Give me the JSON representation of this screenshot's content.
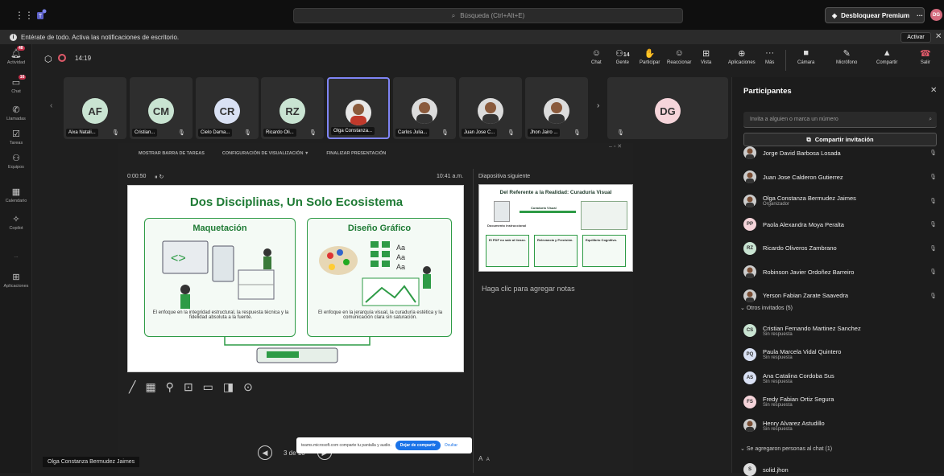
{
  "topbar": {
    "search_placeholder": "Búsqueda (Ctrl+Alt+E)",
    "premium_label": "Desbloquear Premium",
    "more": "···",
    "avatar": "DG"
  },
  "notif": {
    "text": "Entérate de todo. Activa las notificaciones de escritorio.",
    "button": "Activar"
  },
  "rail": [
    {
      "label": "Actividad",
      "badge": "48",
      "icon": "bell-icon"
    },
    {
      "label": "Chat",
      "badge": "16",
      "icon": "chat-icon"
    },
    {
      "label": "Llamadas",
      "icon": "phone-icon"
    },
    {
      "label": "Tareas",
      "icon": "tasks-icon"
    },
    {
      "label": "Equipos",
      "icon": "teams-icon"
    },
    {
      "label": "Calendario",
      "icon": "calendar-icon"
    },
    {
      "label": "Copilot",
      "icon": "copilot-icon"
    },
    {
      "label": "···",
      "icon": "more-icon"
    },
    {
      "label": "Aplicaciones",
      "icon": "apps-icon"
    }
  ],
  "meeting": {
    "timer": "14:19",
    "toolbar": [
      {
        "label": "Chat"
      },
      {
        "label": "Gente",
        "count": "14"
      },
      {
        "label": "Participar"
      },
      {
        "label": "Reaccionar"
      },
      {
        "label": "Vista"
      },
      {
        "label": "Aplicaciones"
      },
      {
        "label": "Más"
      },
      {
        "label": "Cámara"
      },
      {
        "label": "Micrófono"
      },
      {
        "label": "Compartir"
      },
      {
        "label": "Salir"
      }
    ]
  },
  "tiles": [
    {
      "initials": "AF",
      "name": "Aixa Natali...",
      "color": "#c9e4d2"
    },
    {
      "initials": "CM",
      "name": "Cristian...",
      "color": "#c9e4d2"
    },
    {
      "initials": "CR",
      "name": "Cielo Dama...",
      "color": "#d9e1f4"
    },
    {
      "initials": "RZ",
      "name": "Ricardo Oli...",
      "color": "#c9e4d2"
    },
    {
      "initials": "",
      "name": "Olga Constanza...",
      "color": "#ddd"
    },
    {
      "initials": "",
      "name": "Carlos Julia...",
      "color": "#ddd"
    },
    {
      "initials": "",
      "name": "Juan Jose C...",
      "color": "#ddd"
    },
    {
      "initials": "",
      "name": "Jhon Jairo ...",
      "color": "#ddd"
    },
    {
      "initials": "DG",
      "name": "",
      "color": "#f5d4da"
    }
  ],
  "presenter": {
    "toolbar": [
      "MOSTRAR BARRA DE TAREAS",
      "CONFIGURACIÓN DE VISUALIZACIÓN ▼",
      "FINALIZAR PRESENTACIÓN"
    ],
    "elapsed": "0:00:50",
    "clock": "10:41 a.m.",
    "next_label": "Diapositiva siguiente",
    "notes": "Haga clic para agregar notas",
    "page": "3 de 10",
    "presenter_name": "Olga Constanza Bermudez Jaimes",
    "share_notice": "teams.microsoft.com comparte tu pantalla y audio.",
    "stop_share": "Dejar de compartir",
    "hide": "Ocultar",
    "font_small": "A",
    "font_large": "A"
  },
  "slide": {
    "title": "Dos Disciplinas, Un Solo Ecosistema",
    "left_heading": "Maquetación",
    "right_heading": "Diseño Gráfico",
    "left_text": "El enfoque en la integridad estructural, la respuesta técnica y la fidelidad absoluta a la fuente.",
    "right_text": "El enfoque en la jerarquía visual, la curaduría estética y la comunicación clara sin saturación.",
    "font_label": "Aa"
  },
  "next_slide": {
    "title": "Del Referente a la Realidad: Curaduría Visual",
    "doc_label": "Documento instruccional",
    "arrow_label": "Curaduría Visual",
    "col1": "El PDF no sale al lienzo.",
    "col2": "Relevancia y Precisión.",
    "col3": "Equilibrio Cognitivo."
  },
  "panel": {
    "title": "Participantes",
    "invite_placeholder": "Invita a alguien o marca un número",
    "share_invite": "Compartir invitación",
    "people": [
      {
        "name": "Jorge David Barbosa Losada",
        "sub": "",
        "photo": true
      },
      {
        "name": "Juan Jose Calderon Gutierrez",
        "sub": "",
        "photo": true
      },
      {
        "name": "Olga Constanza Bermudez Jaimes",
        "sub": "Organizador",
        "photo": true
      },
      {
        "name": "Paola Alexandra Moya Peralta",
        "sub": "",
        "initials": "PP",
        "color": "#f5d4da"
      },
      {
        "name": "Ricardo Oliveros Zambrano",
        "sub": "",
        "initials": "RZ",
        "color": "#c9e4d2"
      },
      {
        "name": "Robinson Javier Ordoñez Barreiro",
        "sub": "",
        "photo": true
      },
      {
        "name": "Yerson Fabian Zarate Saavedra",
        "sub": "",
        "photo": true
      }
    ],
    "guests_header": "Otros invitados (5)",
    "guests": [
      {
        "name": "Cristian Fernando Martinez Sanchez",
        "sub": "Sin respuesta",
        "initials": "CS",
        "color": "#c9e4d2"
      },
      {
        "name": "Paula Marcela Vidal Quintero",
        "sub": "Sin respuesta",
        "initials": "PQ",
        "color": "#d9e1f4"
      },
      {
        "name": "Ana Catalina Cordoba Sus",
        "sub": "Sin respuesta",
        "initials": "AS",
        "color": "#d9e1f4"
      },
      {
        "name": "Fredy Fabian Ortiz Segura",
        "sub": "Sin respuesta",
        "initials": "FS",
        "color": "#f5d4da"
      },
      {
        "name": "Henry Alvarez Astudillo",
        "sub": "Sin respuesta",
        "photo": true
      }
    ],
    "added_header": "Se agregaron personas al chat (1)",
    "added": [
      {
        "name": "solid.jhon",
        "initials": "S"
      }
    ]
  }
}
